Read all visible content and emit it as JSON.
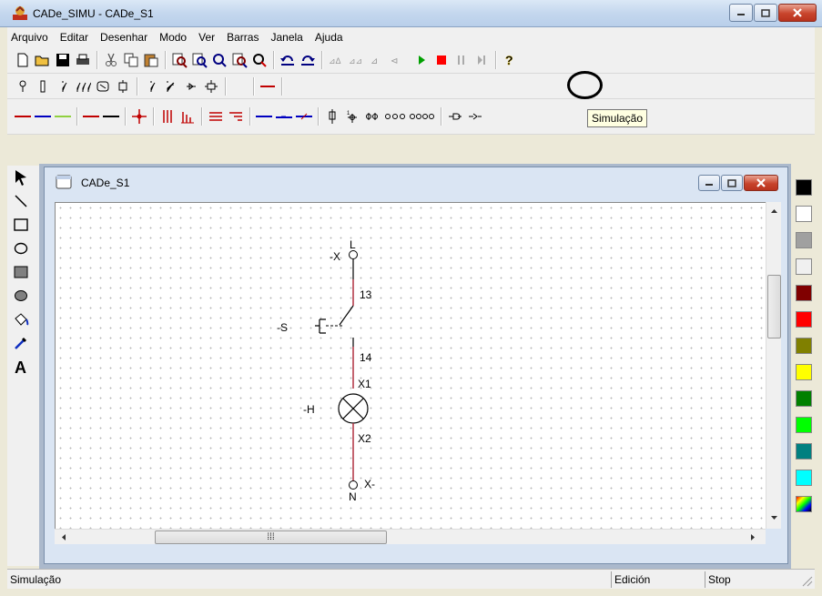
{
  "window": {
    "title": "CADe_SIMU - CADe_S1"
  },
  "menu": [
    "Arquivo",
    "Editar",
    "Desenhar",
    "Modo",
    "Ver",
    "Barras",
    "Janela",
    "Ajuda"
  ],
  "tooltip": "Simulação",
  "child": {
    "title": "CADe_S1"
  },
  "diagram": {
    "top_terminal": "L",
    "top_terminal_ref": "-X",
    "contact_top": "13",
    "switch_ref": "-S",
    "contact_bottom": "14",
    "lamp_top": "X1",
    "lamp_ref": "-H",
    "lamp_bottom": "X2",
    "bottom_terminal_ref": "X-",
    "bottom_terminal": "N"
  },
  "status": {
    "left": "Simulação",
    "mode": "Edición",
    "state": "Stop"
  },
  "colors": {
    "accent_red": "#ff0000",
    "sim_play": "#00a000",
    "wire": "#b03040"
  },
  "palette": [
    "#000000",
    "#ffffff",
    "#a0a0a0",
    "#f0f0f0",
    "#800000",
    "#ff0000",
    "#808000",
    "#ffff00",
    "#008000",
    "#00ff00",
    "#008080",
    "#00ffff",
    "multicolor"
  ],
  "icons": {
    "toolbar1": [
      "new-icon",
      "open-icon",
      "save-icon",
      "print-icon",
      "cut-icon",
      "copy-icon",
      "paste-icon",
      "zoom-in-icon",
      "zoom-out-icon",
      "zoom-area-icon",
      "zoom-all-icon",
      "zoom-fit-icon",
      "undo-icon",
      "redo-icon",
      "simulation-play-icon",
      "simulation-stop-icon",
      "simulation-pause-icon",
      "simulation-step-icon",
      "help-icon"
    ],
    "left_tools": [
      "select-arrow-icon",
      "line-icon",
      "rectangle-icon",
      "ellipse-icon",
      "filled-rectangle-icon",
      "filled-ellipse-icon",
      "fill-bucket-icon",
      "color-picker-icon",
      "text-icon"
    ]
  }
}
